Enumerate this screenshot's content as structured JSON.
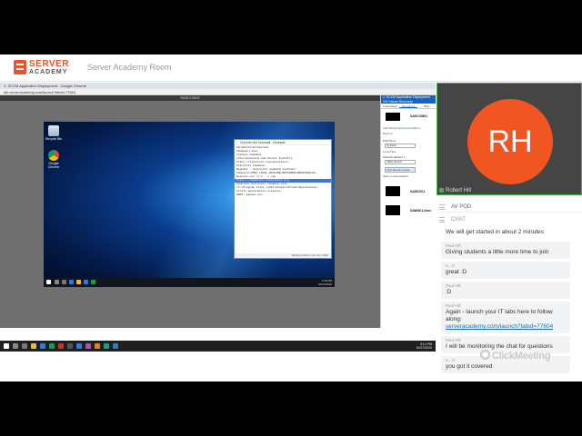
{
  "app": {
    "brand_line1": "SERVER",
    "brand_line2": "ACADEMY",
    "room_title": "Server Academy Room"
  },
  "shared_screen": {
    "browser_title": "1. SCCM Application Deployment - Google Chrome",
    "browser_url": "lab.serveracademy.com/launch?labid=77604",
    "rdp_title": "SASCCM01",
    "desktop_icons": [
      {
        "label": "Recycle Bin",
        "icon": "recycle-bin-icon"
      },
      {
        "label": "Google Chrome",
        "icon": "chrome-icon"
      }
    ],
    "notepad": {
      "title": "Chrome Msi Uninstall - Notepad",
      "menu": "File  Edit  Format  View  Help",
      "lines": [
        "Command Lines",
        "",
        "Install Command",
        "",
        "(Prerequisites and Silent Install)",
        "https://superuser.com/questions/",
        "",
        "Uninstall Command",
        "",
        "Regedit - Uninstall command location",
        "Computer\\HKEY_LOCAL_MACHINE\\SOFTWARE\\WOW6432Node\\",
        "",
        "msiexec.exe /x {...} /qn",
        "https://community.chocolatey.org",
        "",
        "Complete Uninstall Command line",
        "",
        "\"C:\\Program Files (x86)\\Google\\Chrome\\Application\\",
        "",
        "Verify application presence",
        "",
        "ROOT, appwiz.cpl"
      ],
      "selected_line_index": 13,
      "status": "Windows (CRLF)   Ln 20, Col 1   100%"
    },
    "vm_clock_time": "3:15 PM",
    "vm_clock_date": "10/27/2020",
    "side_panel": {
      "header": "1. SCCM Application Deployment",
      "subheader": "VM Failure Recovery",
      "tabs": [
        "Instructions",
        "Resources",
        "FAQ"
      ],
      "active_tab": "Resources",
      "vm1_name": "SASCCM01",
      "admin_label": "Administrator@serveracademy",
      "refresh_label": "Refresh",
      "dvd_label": "DVD Drive",
      "dvd_value": "No Media",
      "local_files": "Local Files",
      "network_label": "Network adapter 1",
      "network_value": "Offline Network",
      "open_btn": "Open Remote Console",
      "new_window": "Open in new window",
      "vm2_name": "SASDC01",
      "vm3_name": "SAWS01-User"
    },
    "host_clock_time": "3:14 PM",
    "host_clock_date": "10/27/2020"
  },
  "webcam": {
    "initials": "RH",
    "presenter": "Robert Hill",
    "avatar_color": "#f05522"
  },
  "panels": {
    "av_pod": "AV POD",
    "chat": "CHAT"
  },
  "chat": {
    "messages": [
      {
        "user": "",
        "text": "We will get started in about 2 minutes",
        "style": "plain"
      },
      {
        "user": "Paul Hill",
        "text": "Giving students a little more time to join",
        "style": "box"
      },
      {
        "user": "K...G",
        "text": "great :D",
        "style": "box"
      },
      {
        "user": "Paul Hill",
        "text": ":D",
        "style": "box"
      },
      {
        "user": "Paul Hill",
        "text": "Again - launch your IT labs here to follow along:",
        "link": "serveracademy.com/launch?labid=77604",
        "style": "box"
      },
      {
        "user": "Paul Hill",
        "text": "I will be monitoring the chat for questions",
        "style": "box"
      },
      {
        "user": "K...G",
        "text": "you got it covered",
        "style": "box"
      }
    ]
  },
  "watermark": "ClickMeeting",
  "colors": {
    "brand": "#e8542d",
    "active_cam_border": "#4caf50",
    "link": "#1a6fc0"
  }
}
